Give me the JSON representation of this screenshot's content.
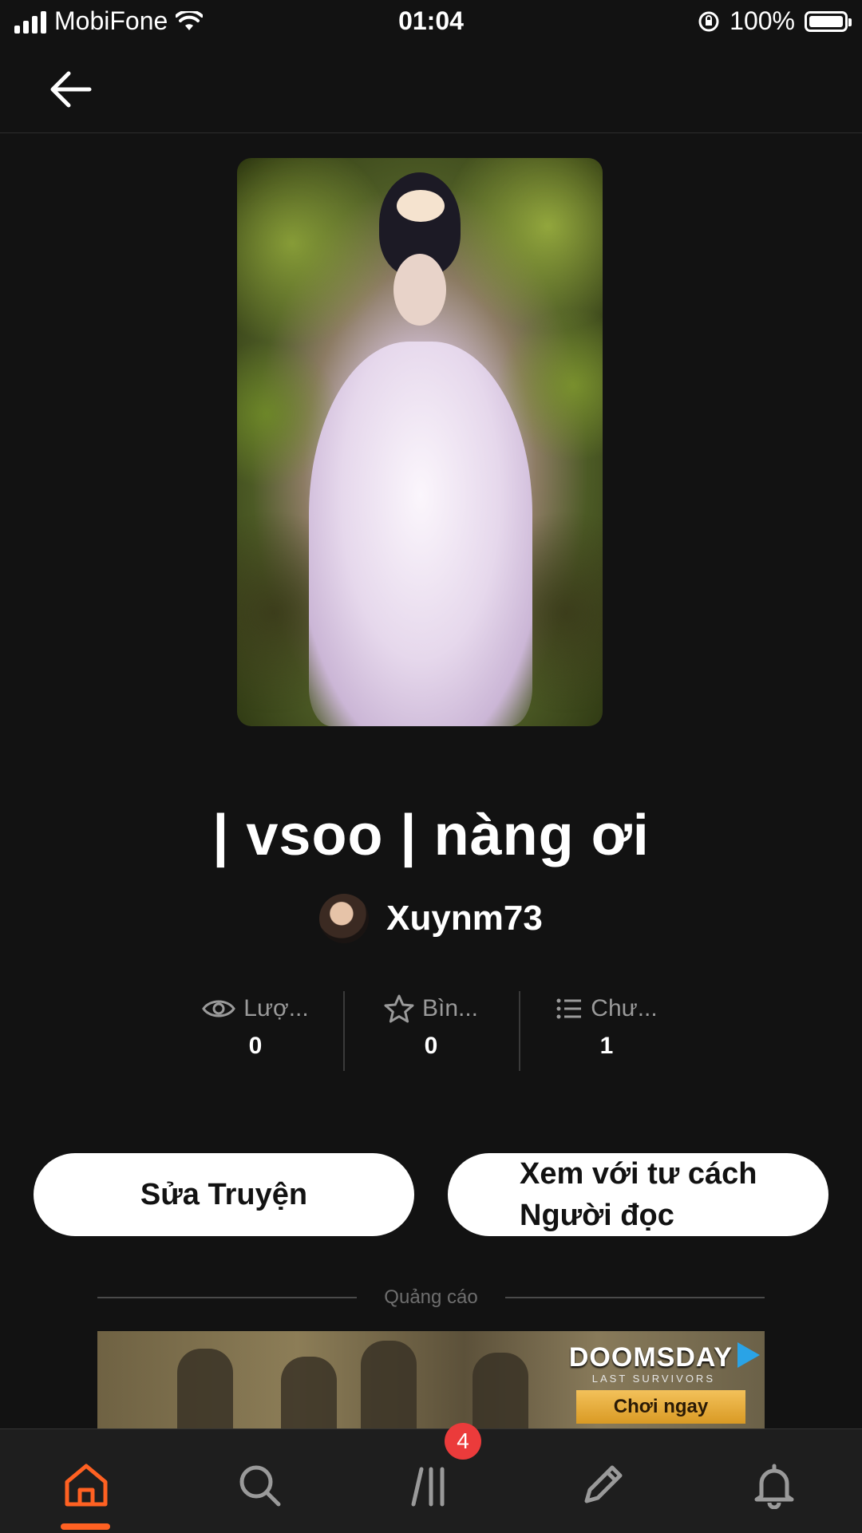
{
  "status_bar": {
    "carrier": "MobiFone",
    "time": "01:04",
    "battery": "100%",
    "icons": [
      "signal-icon",
      "wifi-icon",
      "rotation-lock-icon",
      "battery-icon"
    ]
  },
  "header": {
    "back_icon": "arrow-left-icon"
  },
  "story": {
    "title": "| vsoo | nàng ơi",
    "author": "Xuynm73",
    "stats": [
      {
        "icon": "eye-icon",
        "label": "Lượ...",
        "value": "0"
      },
      {
        "icon": "star-icon",
        "label": "Bìn...",
        "value": "0"
      },
      {
        "icon": "list-icon",
        "label": "Chư...",
        "value": "1"
      }
    ]
  },
  "actions": {
    "edit_label": "Sửa Truyện",
    "read_line1": "Xem với tư cách",
    "read_line2": "Người đọc"
  },
  "ad": {
    "label": "Quảng cáo",
    "brand": "DOOMSDAY",
    "tagline": "LAST SURVIVORS",
    "cta": "Chơi ngay"
  },
  "bottom_nav": {
    "items": [
      "home-icon",
      "search-icon",
      "library-icon",
      "pencil-icon",
      "bell-icon"
    ],
    "active": "home-icon",
    "library_badge": "4",
    "active_color": "#ff6122"
  }
}
